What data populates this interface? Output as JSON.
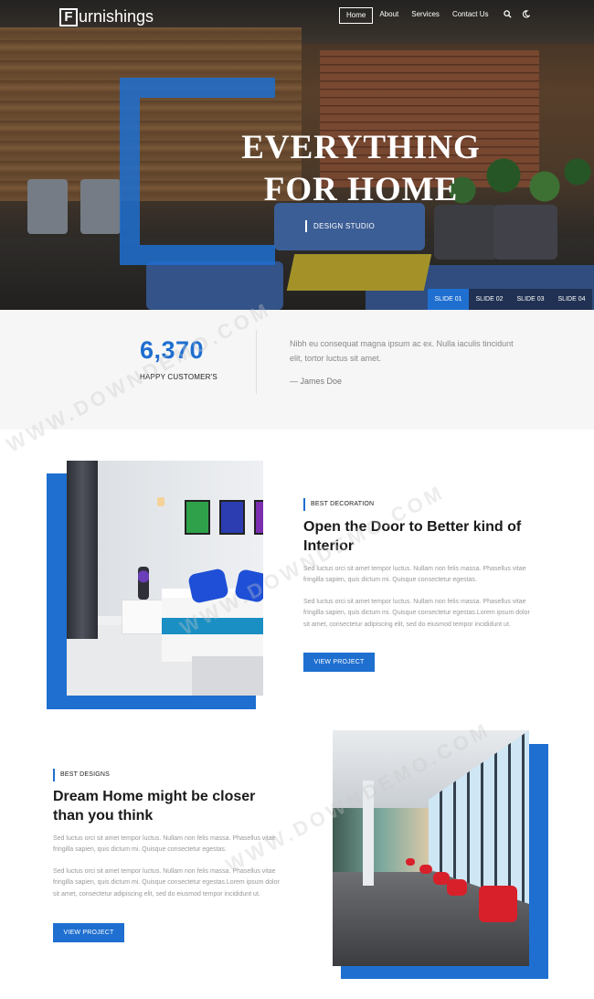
{
  "header": {
    "logo_letter": "F",
    "logo_text": "urnishings",
    "nav": [
      "Home",
      "About",
      "Services",
      "Contact Us"
    ],
    "icons": [
      "search-icon",
      "moon-icon"
    ]
  },
  "hero": {
    "title_line1": "EVERYTHING",
    "title_line2": "FOR HOME",
    "subtitle": "DESIGN STUDIO",
    "slides": [
      "SLIDE 01",
      "SLIDE 02",
      "SLIDE 03",
      "SLIDE 04"
    ],
    "active_slide": 0
  },
  "stats": {
    "number": "6,370",
    "label": "HAPPY CUSTOMER'S",
    "quote": "Nibh eu consequat magna ipsum ac ex. Nulla iaculis tincidunt elit, tortor luctus sit amet.",
    "author": "— James Doe"
  },
  "section1": {
    "tag": "BEST DECORATION",
    "heading": "Open the Door to Better kind of Interior",
    "para1": "Sed luctus orci sit amet tempor luctus. Nullam non felis massa. Phasellus vitae fringilla sapien, quis dictum mi. Quisque consectetur egestas.",
    "para2": "Sed luctus orci sit amet tempor luctus. Nullam non felis massa. Phasellus vitae fringilla sapien, quis dictum mi. Quisque consectetur egestas.Lorem ipsum dolor sit amet, consectetur adipiscing elit, sed do eiusmod tempor incididunt ut.",
    "button": "VIEW PROJECT"
  },
  "section2": {
    "tag": "BEST DESIGNS",
    "heading": "Dream Home might be closer than you think",
    "para1": "Sed luctus orci sit amet tempor luctus. Nullam non felis massa. Phasellus vitae fringilla sapien, quis dictum mi. Quisque consectetur egestas.",
    "para2": "Sed luctus orci sit amet tempor luctus. Nullam non felis massa. Phasellus vitae fringilla sapien, quis dictum mi. Quisque consectetur egestas.Lorem ipsum dolor sit amet, consectetur adipiscing elit, sed do eiusmod tempor incididunt ut.",
    "button": "VIEW PROJECT"
  },
  "watermark": "WWW.DOWNDEMO.COM",
  "colors": {
    "accent": "#1e6fd0",
    "text": "#1a1a1a",
    "muted": "#999999"
  }
}
